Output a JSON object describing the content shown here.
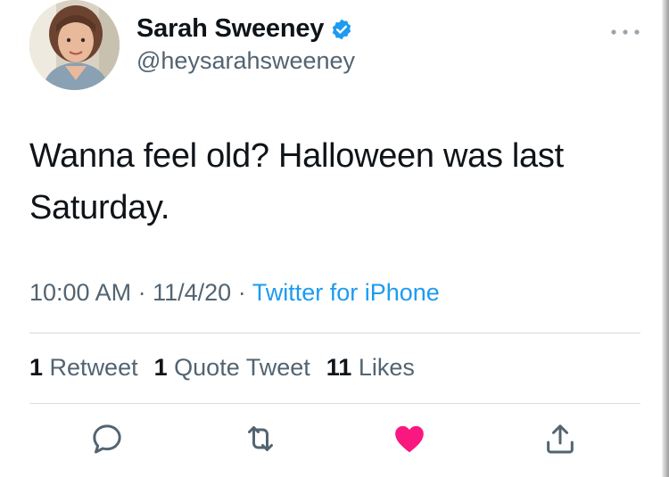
{
  "user": {
    "display_name": "Sarah Sweeney",
    "handle": "@heysarahsweeney",
    "verified": true
  },
  "tweet": {
    "text": "Wanna feel old? Halloween was last Saturday.",
    "time": "10:00 AM",
    "date": "11/4/20",
    "separator": "·",
    "source": "Twitter for iPhone"
  },
  "stats": {
    "retweets_count": "1",
    "retweets_label": "Retweet",
    "quotes_count": "1",
    "quotes_label": "Quote Tweet",
    "likes_count": "11",
    "likes_label": "Likes"
  },
  "actions": [
    "reply-icon",
    "retweet-icon",
    "like-icon",
    "share-icon"
  ],
  "colors": {
    "accent": "#1d9bf0",
    "like": "#f91880",
    "secondary_text": "#536471"
  }
}
